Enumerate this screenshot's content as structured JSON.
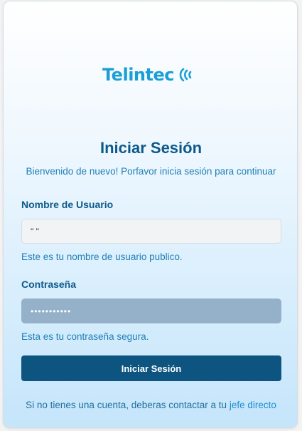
{
  "brand": {
    "logo_text": "Telintec",
    "accent": "#1a9ed6",
    "waves_icon": "signal-waves-icon"
  },
  "login": {
    "title": "Iniciar Sesión",
    "subtitle": "Bienvenido de nuevo! Porfavor inicia sesión para continuar",
    "username": {
      "label": "Nombre de Usuario",
      "value": "\" \"",
      "hint": "Este es tu nombre de usuario publico."
    },
    "password": {
      "label": "Contraseña",
      "value": "•••••••••••",
      "hint": "Esta es tu contraseña segura."
    },
    "submit_label": "Iniciar Sesión",
    "footer_text": "Si no tienes una cuenta, deberas contactar a tu ",
    "footer_link": "jefe directo"
  },
  "colors": {
    "primary": "#0d5580",
    "title": "#0d5a8a",
    "hint": "#1f7fb7",
    "password_bg": "#95b1c9"
  }
}
